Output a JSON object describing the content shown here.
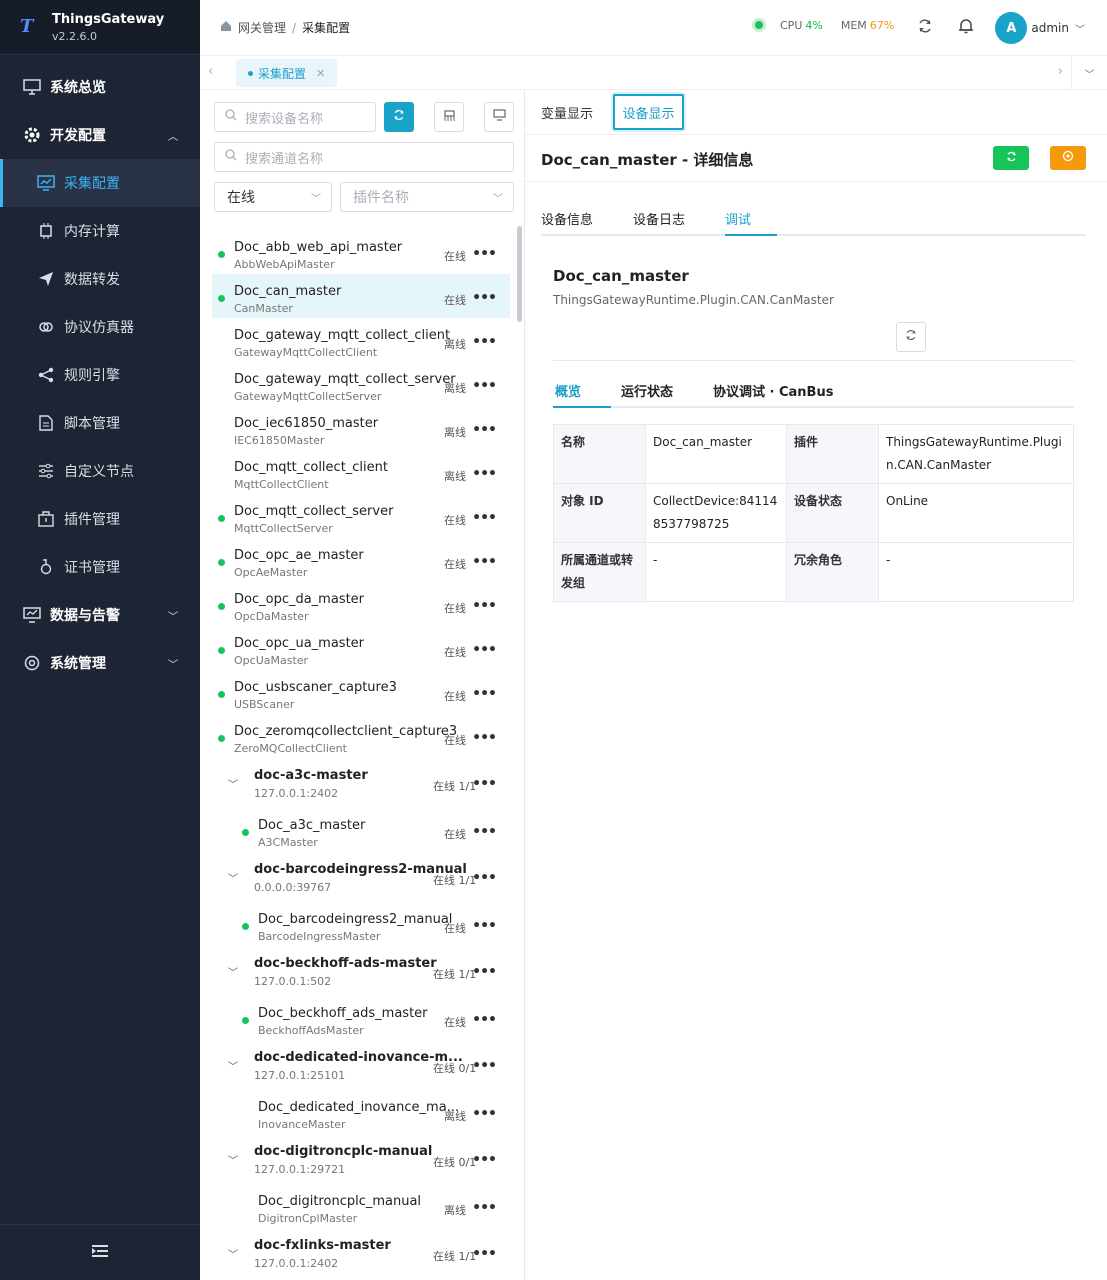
{
  "app": {
    "name": "ThingsGateway",
    "version": "v2.2.6.0"
  },
  "sidebar": {
    "items": [
      {
        "label": "系统总览",
        "icon": "monitor-icon"
      },
      {
        "label": "开发配置",
        "icon": "gear-icon",
        "expanded": true
      },
      {
        "label": "采集配置",
        "icon": "chart-monitor-icon",
        "active": true
      },
      {
        "label": "内存计算",
        "icon": "chip-icon"
      },
      {
        "label": "数据转发",
        "icon": "send-icon"
      },
      {
        "label": "协议仿真器",
        "icon": "link-icon"
      },
      {
        "label": "规则引擎",
        "icon": "share-icon"
      },
      {
        "label": "脚本管理",
        "icon": "file-icon"
      },
      {
        "label": "自定义节点",
        "icon": "sliders-icon"
      },
      {
        "label": "插件管理",
        "icon": "package-icon"
      },
      {
        "label": "证书管理",
        "icon": "cert-icon"
      },
      {
        "label": "数据与告警",
        "icon": "monitor-icon"
      },
      {
        "label": "系统管理",
        "icon": "gear-icon"
      }
    ]
  },
  "header": {
    "breadcrumb_root": "网关管理",
    "breadcrumb_sep": "/",
    "breadcrumb_current": "采集配置",
    "cpu_label": "CPU",
    "cpu_value": "4%",
    "mem_label": "MEM",
    "mem_value": "67%",
    "avatar_letter": "A",
    "user": "admin"
  },
  "tabs": {
    "active": "采集配置"
  },
  "left": {
    "search_device_placeholder": "搜索设备名称",
    "search_channel_placeholder": "搜索通道名称",
    "status_select": "在线",
    "plugin_select_placeholder": "插件名称"
  },
  "devices": [
    {
      "name": "Doc_abb_web_api_master",
      "plugin": "AbbWebApiMaster",
      "status": "在线",
      "online": true
    },
    {
      "name": "Doc_can_master",
      "plugin": "CanMaster",
      "status": "在线",
      "online": true,
      "selected": true
    },
    {
      "name": "Doc_gateway_mqtt_collect_client",
      "plugin": "GatewayMqttCollectClient",
      "status": "离线",
      "online": false
    },
    {
      "name": "Doc_gateway_mqtt_collect_server",
      "plugin": "GatewayMqttCollectServer",
      "status": "离线",
      "online": false
    },
    {
      "name": "Doc_iec61850_master",
      "plugin": "IEC61850Master",
      "status": "离线",
      "online": false
    },
    {
      "name": "Doc_mqtt_collect_client",
      "plugin": "MqttCollectClient",
      "status": "离线",
      "online": false
    },
    {
      "name": "Doc_mqtt_collect_server",
      "plugin": "MqttCollectServer",
      "status": "在线",
      "online": true
    },
    {
      "name": "Doc_opc_ae_master",
      "plugin": "OpcAeMaster",
      "status": "在线",
      "online": true
    },
    {
      "name": "Doc_opc_da_master",
      "plugin": "OpcDaMaster",
      "status": "在线",
      "online": true
    },
    {
      "name": "Doc_opc_ua_master",
      "plugin": "OpcUaMaster",
      "status": "在线",
      "online": true
    },
    {
      "name": "Doc_usbscaner_capture3",
      "plugin": "USBScaner",
      "status": "在线",
      "online": true
    },
    {
      "name": "Doc_zeromqcollectclient_capture3",
      "plugin": "ZeroMQCollectClient",
      "status": "在线",
      "online": true
    }
  ],
  "channels": [
    {
      "name": "doc-a3c-master",
      "addr": "127.0.0.1:2402",
      "status": "在线 1/1",
      "device": {
        "name": "Doc_a3c_master",
        "plugin": "A3CMaster",
        "status": "在线",
        "online": true
      }
    },
    {
      "name": "doc-barcodeingress2-manual",
      "addr": "0.0.0.0:39767",
      "status": "在线 1/1",
      "device": {
        "name": "Doc_barcodeingress2_manual",
        "plugin": "BarcodeIngressMaster",
        "status": "在线",
        "online": true
      }
    },
    {
      "name": "doc-beckhoff-ads-master",
      "addr": "127.0.0.1:502",
      "status": "在线 1/1",
      "device": {
        "name": "Doc_beckhoff_ads_master",
        "plugin": "BeckhoffAdsMaster",
        "status": "在线",
        "online": true
      }
    },
    {
      "name": "doc-dedicated-inovance-m...",
      "addr": "127.0.0.1:25101",
      "status": "在线 0/1",
      "device": {
        "name": "Doc_dedicated_inovance_ma...",
        "plugin": "InovanceMaster",
        "status": "离线",
        "online": false
      }
    },
    {
      "name": "doc-digitroncplc-manual",
      "addr": "127.0.0.1:29721",
      "status": "在线 0/1",
      "device": {
        "name": "Doc_digitroncplc_manual",
        "plugin": "DigitronCplMaster",
        "status": "离线",
        "online": false
      }
    },
    {
      "name": "doc-fxlinks-master",
      "addr": "127.0.0.1:2402",
      "status": "在线 1/1",
      "device": null
    }
  ],
  "right": {
    "tab_var": "变量显示",
    "tab_dev": "设备显示",
    "title": "Doc_can_master - 详细信息",
    "subtabs": [
      "设备信息",
      "设备日志",
      "调试"
    ],
    "device_name": "Doc_can_master",
    "device_class": "ThingsGatewayRuntime.Plugin.CAN.CanMaster",
    "inner_tabs": [
      "概览",
      "运行状态",
      "协议调试 · CanBus"
    ],
    "info": {
      "name_k": "名称",
      "name_v": "Doc_can_master",
      "plugin_k": "插件",
      "plugin_v": "ThingsGatewayRuntime.Plugin.CAN.CanMaster",
      "id_k": "对象 ID",
      "id_v": "CollectDevice:841148537798725",
      "status_k": "设备状态",
      "status_v": "OnLine",
      "group_k": "所属通道或转发组",
      "group_v": "-",
      "role_k": "冗余角色",
      "role_v": "-"
    }
  },
  "colors": {
    "accent": "#1aa3c9",
    "online": "#16c45a",
    "sidebar": "#1d2433",
    "green_btn": "#16c45a",
    "orange_btn": "#f59a0c"
  }
}
